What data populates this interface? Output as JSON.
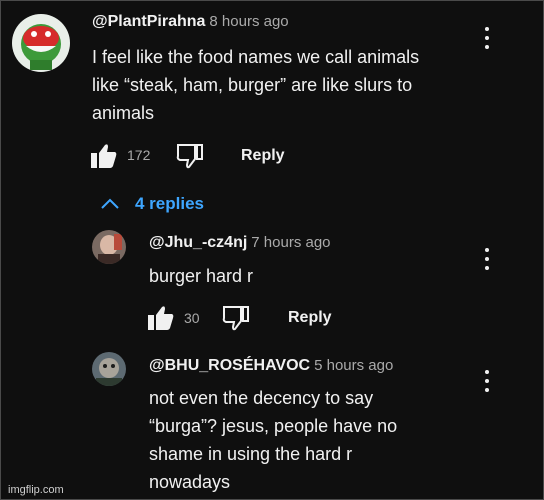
{
  "comment": {
    "author": "@PlantPirahna",
    "time": "8 hours ago",
    "text_lines": [
      "I feel like the food names we call animals",
      "like “steak, ham, burger” are like slurs to",
      "animals"
    ],
    "likes": "172",
    "reply_label": "Reply"
  },
  "replies_toggle": "4 replies",
  "replies": [
    {
      "author": "@Jhu_-cz4nj",
      "time": "7 hours ago",
      "text_lines": [
        "burger hard r"
      ],
      "likes": "30",
      "reply_label": "Reply"
    },
    {
      "author": "@BHU_ROSÉHAVOC",
      "time": "5 hours ago",
      "text_lines": [
        "not even the decency to say",
        "“burga”? jesus, people have no",
        "shame in using the hard r",
        "nowadays"
      ]
    }
  ],
  "watermark": "imgflip.com",
  "icons": [
    "thumb-up-icon",
    "thumb-down-icon",
    "chevron-up-icon",
    "more-vert-icon"
  ],
  "colors": {
    "background": "#0f0f0f",
    "link": "#3ea6ff",
    "secondary": "#aaaaaa"
  }
}
